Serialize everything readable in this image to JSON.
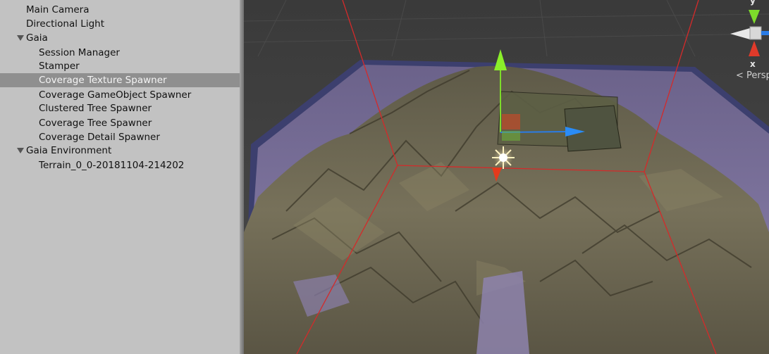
{
  "hierarchy": {
    "items": [
      {
        "label": "Main Camera",
        "expanded": null,
        "selected": false
      },
      {
        "label": "Directional Light",
        "expanded": null,
        "selected": false
      },
      {
        "label": "Gaia",
        "expanded": true,
        "selected": false
      },
      {
        "label": "Session Manager",
        "expanded": null,
        "selected": false
      },
      {
        "label": "Stamper",
        "expanded": null,
        "selected": false
      },
      {
        "label": "Coverage Texture Spawner",
        "expanded": null,
        "selected": true
      },
      {
        "label": "Coverage GameObject Spawner",
        "expanded": null,
        "selected": false
      },
      {
        "label": "Clustered Tree Spawner",
        "expanded": null,
        "selected": false
      },
      {
        "label": "Coverage Tree Spawner",
        "expanded": null,
        "selected": false
      },
      {
        "label": "Coverage Detail Spawner",
        "expanded": null,
        "selected": false
      },
      {
        "label": "Gaia Environment",
        "expanded": true,
        "selected": false
      },
      {
        "label": "Terrain_0_0-20181104-214202",
        "expanded": null,
        "selected": false
      }
    ]
  },
  "scene": {
    "projection_label": "< Persp",
    "gizmo": {
      "x_label": "x",
      "y_label": "y"
    },
    "colors": {
      "background": "#404040",
      "terrain": "#6e6a55",
      "water": "#7a6e98",
      "bounds": "#d42a2a",
      "axis_x": "#e03a2a",
      "axis_y": "#7ddc2a",
      "axis_z": "#2a7ce6"
    }
  }
}
